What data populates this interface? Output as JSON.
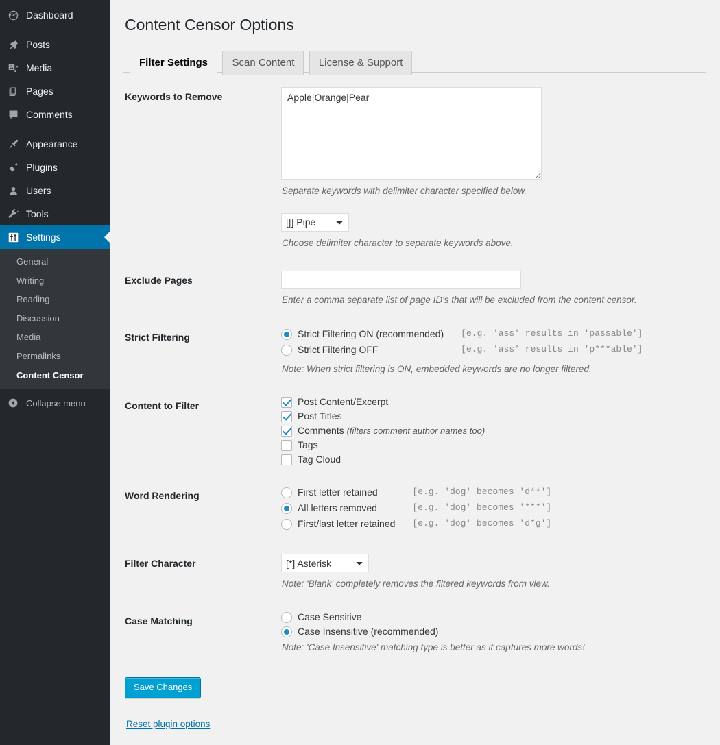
{
  "sidebar": {
    "menu": [
      {
        "label": "Dashboard",
        "icon": "dashboard-icon"
      },
      {
        "label": "Posts",
        "icon": "pin-icon"
      },
      {
        "label": "Media",
        "icon": "media-icon"
      },
      {
        "label": "Pages",
        "icon": "pages-icon"
      },
      {
        "label": "Comments",
        "icon": "comments-icon"
      },
      {
        "label": "Appearance",
        "icon": "appearance-brush-icon"
      },
      {
        "label": "Plugins",
        "icon": "plugin-icon"
      },
      {
        "label": "Users",
        "icon": "user-icon"
      },
      {
        "label": "Tools",
        "icon": "wrench-icon"
      },
      {
        "label": "Settings",
        "icon": "settings-sliders-icon"
      }
    ],
    "submenu": [
      {
        "label": "General",
        "active": false
      },
      {
        "label": "Writing",
        "active": false
      },
      {
        "label": "Reading",
        "active": false
      },
      {
        "label": "Discussion",
        "active": false
      },
      {
        "label": "Media",
        "active": false
      },
      {
        "label": "Permalinks",
        "active": false
      },
      {
        "label": "Content Censor",
        "active": true
      }
    ],
    "collapse_label": "Collapse menu",
    "accent_color": "#0073aa",
    "background_color": "#23282d",
    "submenu_background": "#32373c"
  },
  "page": {
    "title": "Content Censor Options"
  },
  "tabs": [
    {
      "label": "Filter Settings",
      "active": true
    },
    {
      "label": "Scan Content",
      "active": false
    },
    {
      "label": "License & Support",
      "active": false
    }
  ],
  "fields": {
    "keywords": {
      "label": "Keywords to Remove",
      "value": "Apple|Orange|Pear",
      "description": "Separate keywords with delimiter character specified below.",
      "delimiter_selected": "[|] Pipe",
      "delimiter_description": "Choose delimiter character to separate keywords above."
    },
    "exclude_pages": {
      "label": "Exclude Pages",
      "value": "",
      "description": "Enter a comma separate list of page ID's that will be excluded from the content censor."
    },
    "strict_filtering": {
      "label": "Strict Filtering",
      "options": [
        {
          "label": "Strict Filtering ON (recommended)",
          "example": "[e.g. 'ass' results in 'passable']",
          "checked": true
        },
        {
          "label": "Strict Filtering OFF",
          "example": "[e.g. 'ass' results in 'p***able']",
          "checked": false
        }
      ],
      "note": "Note: When strict filtering is ON, embedded keywords are no longer filtered."
    },
    "content_to_filter": {
      "label": "Content to Filter",
      "options": [
        {
          "label": "Post Content/Excerpt",
          "note": "",
          "checked": true
        },
        {
          "label": "Post Titles",
          "note": "",
          "checked": true
        },
        {
          "label": "Comments",
          "note": "(filters comment author names too)",
          "checked": true
        },
        {
          "label": "Tags",
          "note": "",
          "checked": false
        },
        {
          "label": "Tag Cloud",
          "note": "",
          "checked": false
        }
      ]
    },
    "word_rendering": {
      "label": "Word Rendering",
      "options": [
        {
          "label": "First letter retained",
          "example": "[e.g. 'dog' becomes 'd**']",
          "checked": false
        },
        {
          "label": "All letters removed",
          "example": "[e.g. 'dog' becomes '***']",
          "checked": true
        },
        {
          "label": "First/last letter retained",
          "example": "[e.g. 'dog' becomes 'd*g']",
          "checked": false
        }
      ]
    },
    "filter_character": {
      "label": "Filter Character",
      "selected": "[*] Asterisk",
      "note": "Note: 'Blank' completely removes the filtered keywords from view."
    },
    "case_matching": {
      "label": "Case Matching",
      "options": [
        {
          "label": "Case Sensitive",
          "checked": false
        },
        {
          "label": "Case Insensitive (recommended)",
          "checked": true
        }
      ],
      "note": "Note: 'Case Insensitive' matching type is better as it captures more words!"
    }
  },
  "actions": {
    "save_label": "Save Changes",
    "reset_label": "Reset plugin options",
    "save_color": "#00a0d2"
  }
}
